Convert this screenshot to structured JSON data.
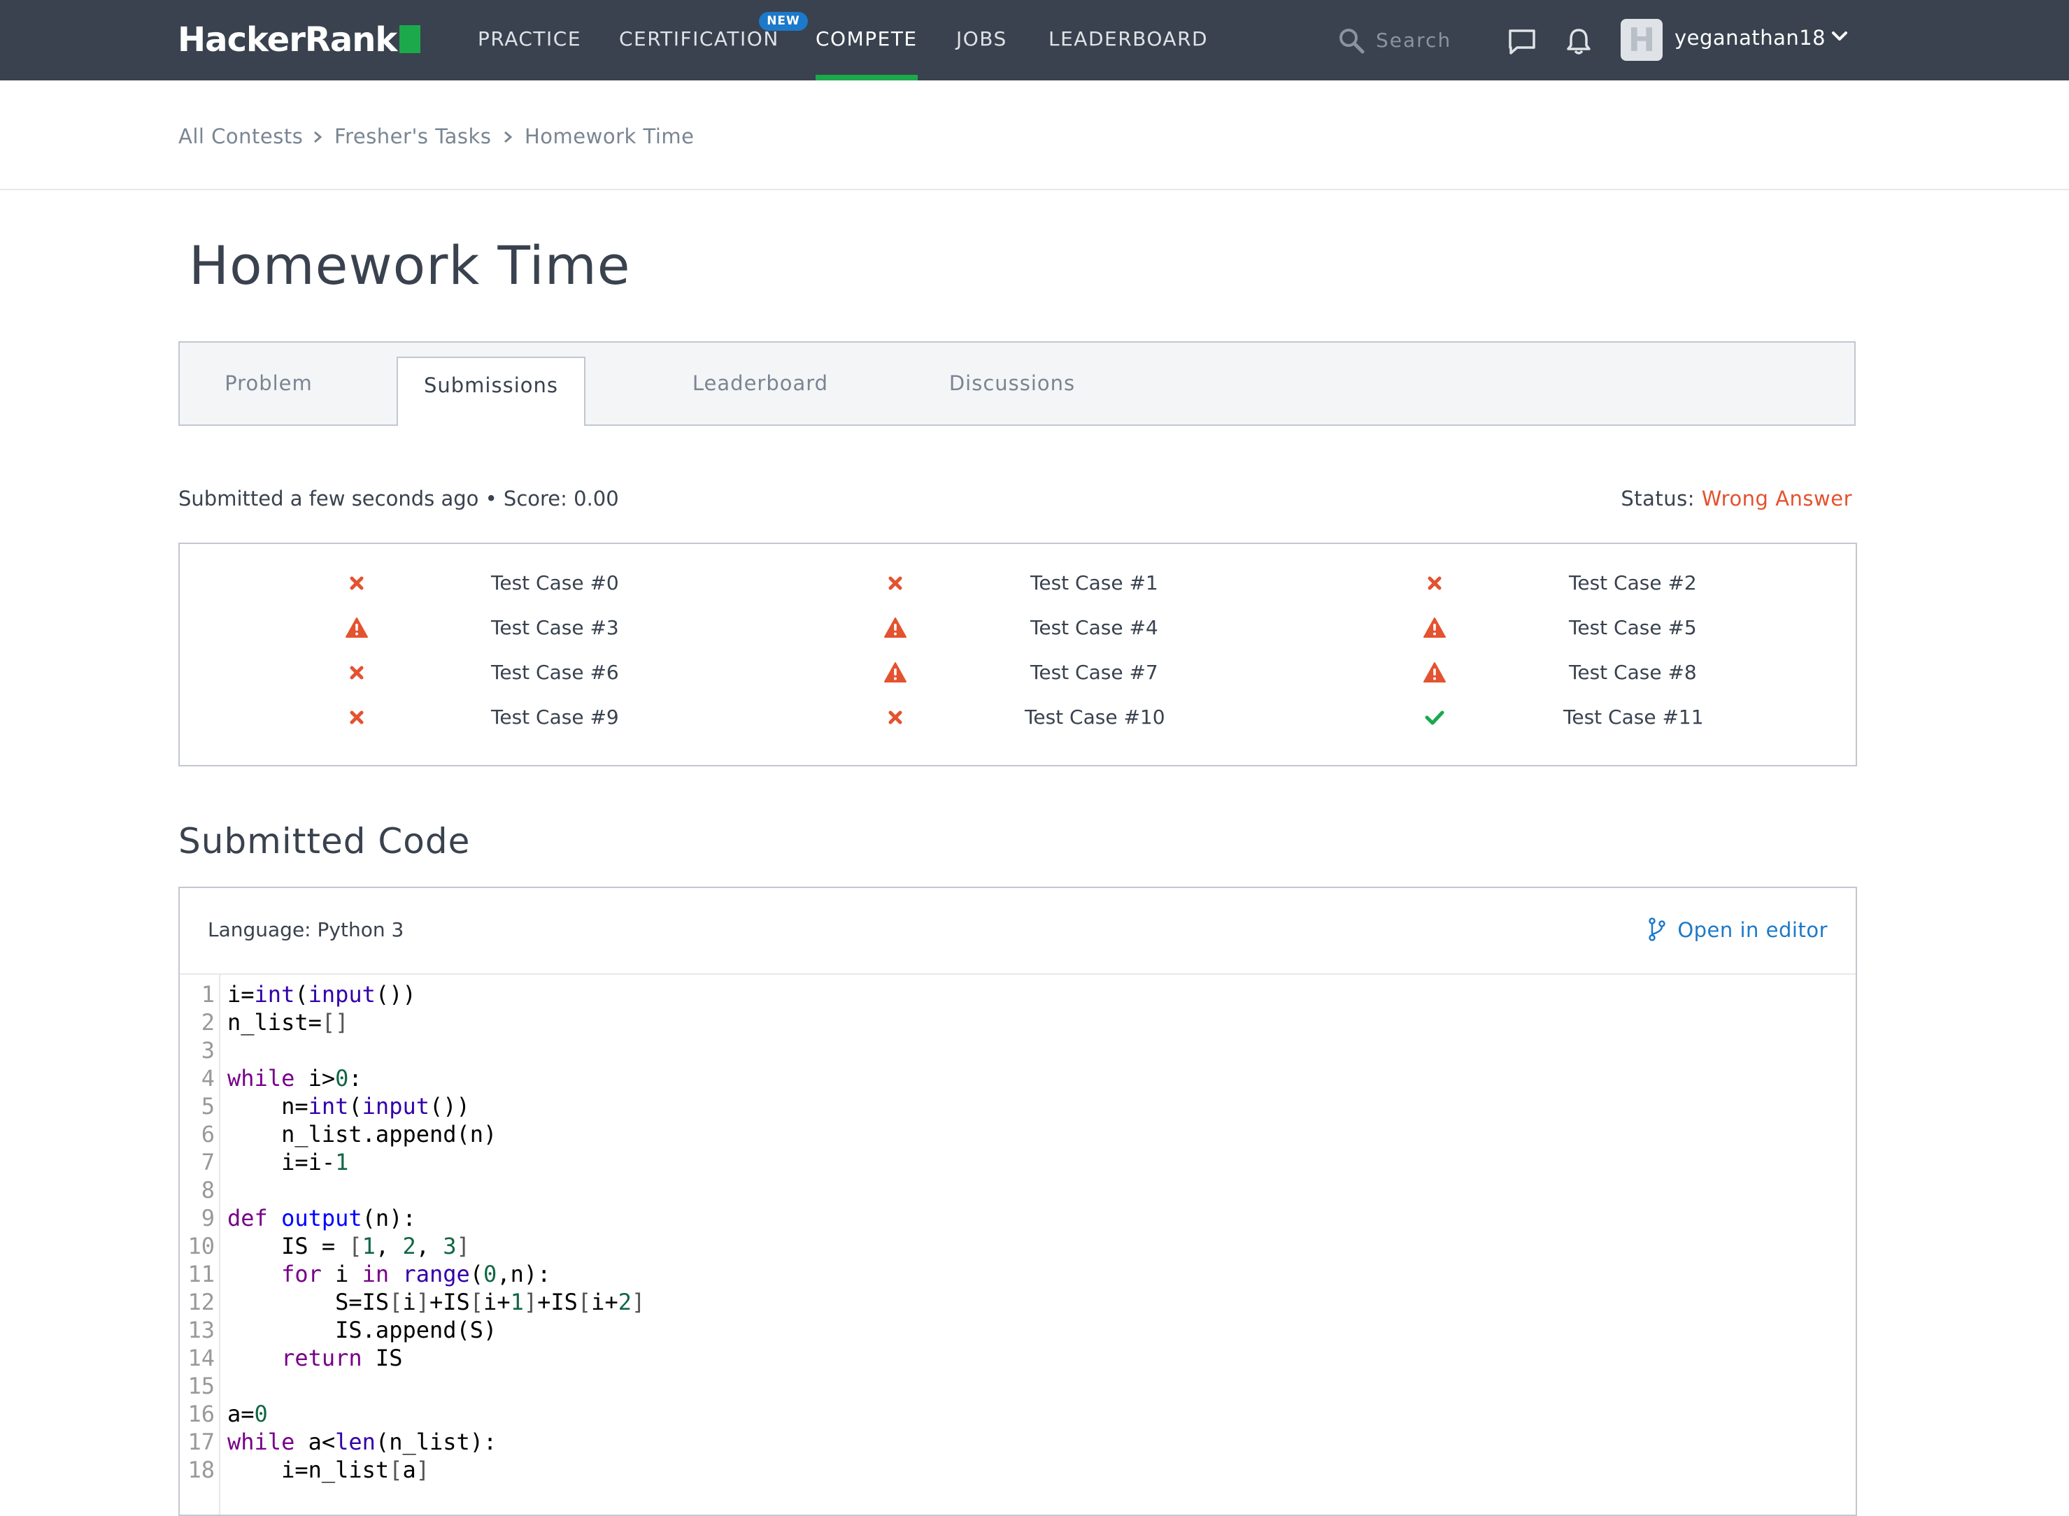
{
  "brand": {
    "name": "HackerRank",
    "accent_color": "#1ba94c",
    "nav_background": "#39424e"
  },
  "nav": {
    "items": [
      {
        "label": "PRACTICE"
      },
      {
        "label": "CERTIFICATION",
        "badge": "NEW"
      },
      {
        "label": "COMPETE",
        "active": true
      },
      {
        "label": "JOBS"
      },
      {
        "label": "LEADERBOARD"
      }
    ],
    "search_placeholder": "Search",
    "icons": [
      "search-icon",
      "message-icon",
      "bell-icon",
      "chevron-down-icon"
    ],
    "user": {
      "avatar_letter": "H",
      "username": "yeganathan18"
    }
  },
  "breadcrumb": [
    "All Contests",
    "Fresher's Tasks",
    "Homework Time"
  ],
  "page_title": "Homework Time",
  "tabs": [
    {
      "label": "Problem"
    },
    {
      "label": "Submissions",
      "active": true
    },
    {
      "label": "Leaderboard"
    },
    {
      "label": "Discussions"
    }
  ],
  "submission": {
    "info": "Submitted a few seconds ago • Score: 0.00",
    "status_label": "Status:",
    "status_value": "Wrong Answer",
    "status_color": "#e4522f"
  },
  "test_cases": [
    {
      "label": "Test Case #0",
      "result": "wrong"
    },
    {
      "label": "Test Case #1",
      "result": "wrong"
    },
    {
      "label": "Test Case #2",
      "result": "wrong"
    },
    {
      "label": "Test Case #3",
      "result": "error"
    },
    {
      "label": "Test Case #4",
      "result": "error"
    },
    {
      "label": "Test Case #5",
      "result": "error"
    },
    {
      "label": "Test Case #6",
      "result": "wrong"
    },
    {
      "label": "Test Case #7",
      "result": "error"
    },
    {
      "label": "Test Case #8",
      "result": "error"
    },
    {
      "label": "Test Case #9",
      "result": "wrong"
    },
    {
      "label": "Test Case #10",
      "result": "wrong"
    },
    {
      "label": "Test Case #11",
      "result": "passed"
    }
  ],
  "result_icons": {
    "wrong": "cross-icon",
    "error": "warning-icon",
    "passed": "check-icon"
  },
  "result_colors": {
    "wrong": "#e4522f",
    "error": "#e4522f",
    "passed": "#1ba94c"
  },
  "code": {
    "heading": "Submitted Code",
    "language": "Language: Python 3",
    "open_in_editor": "Open in editor",
    "lines": [
      "i=int(input())",
      "n_list=[]",
      "",
      "while i>0:",
      "    n=int(input())",
      "    n_list.append(n)",
      "    i=i-1",
      "",
      "def output(n):",
      "    IS = [1, 2, 3]",
      "    for i in range(0,n):",
      "        S=IS[i]+IS[i+1]+IS[i+2]",
      "        IS.append(S)",
      "    return IS",
      "",
      "a=0",
      "while a<len(n_list):",
      "    i=n_list[a]"
    ]
  }
}
